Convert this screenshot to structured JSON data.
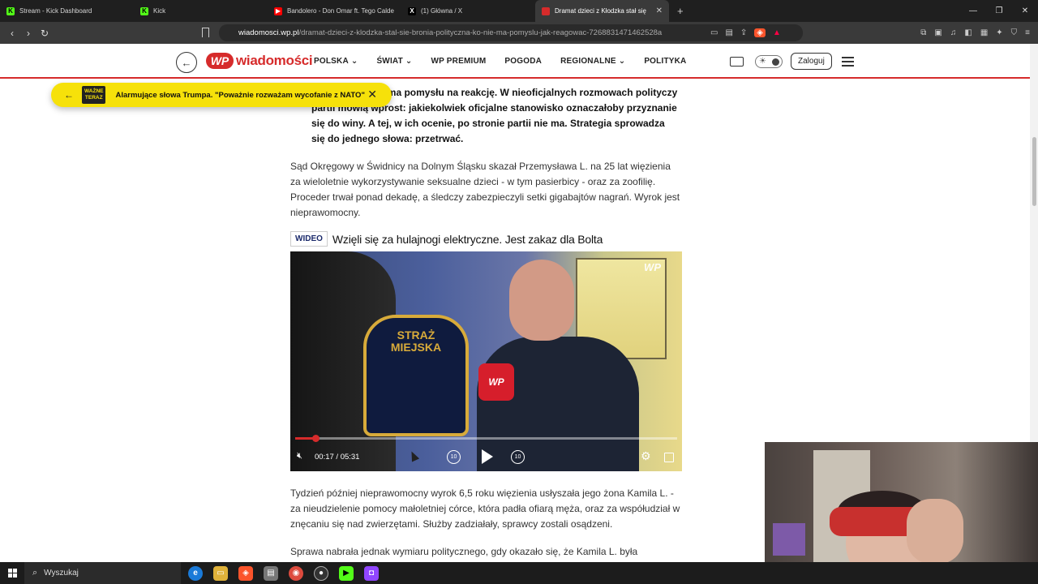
{
  "browser": {
    "tabs": [
      {
        "label": "Stream - Kick Dashboard",
        "icon": "kick-icon"
      },
      {
        "label": "Kick",
        "icon": "kick-icon"
      },
      {
        "label": "Bandolero - Don Omar ft. Tego Calde",
        "icon": "youtube-icon"
      },
      {
        "label": "(1) Główna / X",
        "icon": "x-icon"
      },
      {
        "label": "Dramat dzieci z Kłodzka stał się",
        "icon": "wp-icon"
      }
    ],
    "new_tab": "+",
    "url_domain": "wiadomosci.wp.pl",
    "url_path": "/dramat-dzieci-z-klodzka-stal-sie-bronia-polityczna-ko-nie-ma-pomyslu-jak-reagowac-7268831471462528a"
  },
  "site": {
    "logo_text": "wiadomości",
    "logo_mark": "WP",
    "menu": [
      "POLSKA",
      "ŚWIAT",
      "WP PREMIUM",
      "POGODA",
      "REGIONALNE",
      "POLITYKA"
    ],
    "menu_has_dropdown": [
      true,
      true,
      false,
      false,
      true,
      false
    ],
    "login_label": "Zaloguj"
  },
  "toast": {
    "badge_line1": "WAŻNE",
    "badge_line2": "TERAZ",
    "message": "Alarmujące słowa Trumpa. \"Poważnie rozważam wycofanie z NATO\""
  },
  "article": {
    "lead": "...eń WP, KO nie ma pomysłu na reakcję. W nieoficjalnych rozmowach polityczy partii mówią wprost: jakiekolwiek oficjalne stanowisko oznaczałoby przyznanie się do winy. A tej, w ich ocenie, po stronie partii nie ma. Strategia sprowadza się do jednego słowa: przetrwać.",
    "paragraph1": "Sąd Okręgowy w Świdnicy na Dolnym Śląsku skazał Przemysława L. na 25 lat więzienia za wieloletnie wykorzystywanie seksualne dzieci - w tym pasierbicy - oraz za zoofilię. Proceder trwał ponad dekadę, a śledczy zabezpieczyli setki gigabajtów nagrań. Wyrok jest nieprawomocny.",
    "video_badge": "WIDEO",
    "video_title": "Wzięli się za hulajnogi elektryczne. Jest zakaz dla Bolta",
    "paragraph2": "Tydzień później nieprawomocny wyrok 6,5 roku więzienia usłyszała jego żona Kamila L. - za nieudzielenie pomocy małoletniej córce, która padła ofiarą męża, oraz za współudział w znęcaniu się nad zwierzętami. Służby zadziałały, sprawcy zostali osądzeni.",
    "paragraph3": "Sprawa nabrała jednak wymiaru politycznego, gdy okazało się, że Kamila L. była wieloletnią"
  },
  "video": {
    "watermark": "WP",
    "patch_text_line1": "STRAŻ",
    "patch_text_line2": "MIEJSKA",
    "mic_text": "WP",
    "time": "00:17 / 05:31",
    "progress_fraction": 0.053,
    "rewind_label": "10",
    "forward_label": "10"
  },
  "taskbar": {
    "search_placeholder": "Wyszukaj"
  },
  "colors": {
    "brand_red": "#d62b2b",
    "toast_yellow": "#f6e10a",
    "video_badge_text": "#1b2a6b"
  }
}
